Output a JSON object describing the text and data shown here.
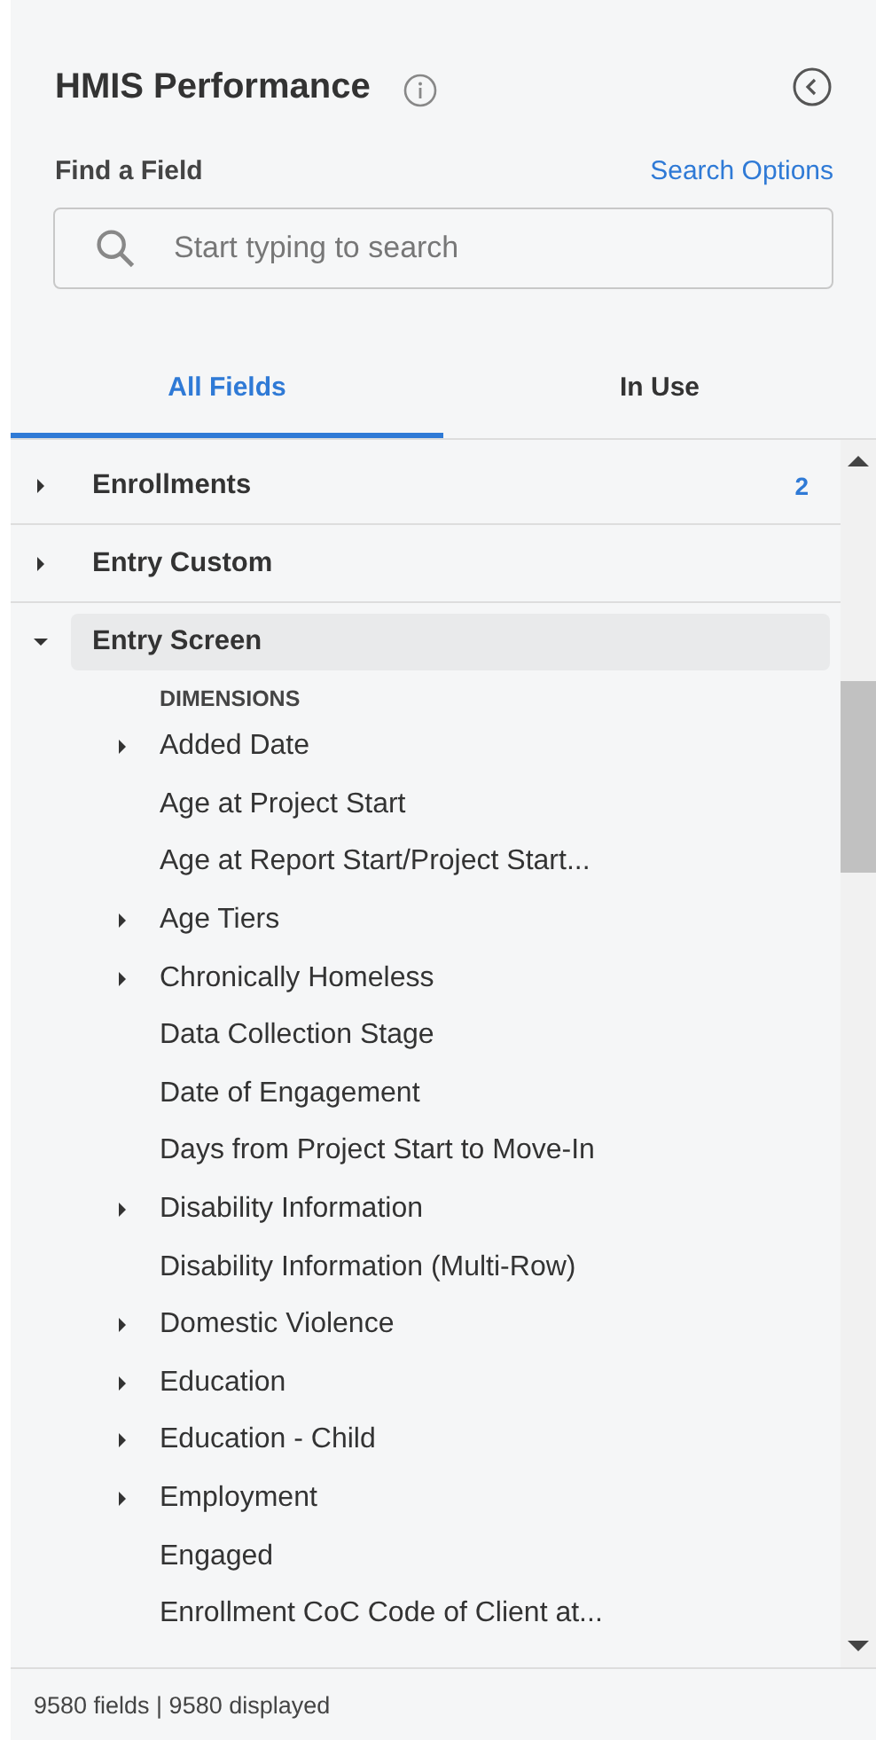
{
  "header": {
    "title": "HMIS Performance"
  },
  "search": {
    "label": "Find a Field",
    "options_link": "Search Options",
    "placeholder": "Start typing to search"
  },
  "tabs": [
    {
      "label": "All Fields",
      "selected": true
    },
    {
      "label": "In Use",
      "selected": false
    }
  ],
  "tree": [
    {
      "label": "Enrollments",
      "expanded": false,
      "count": "2"
    },
    {
      "label": "Entry Custom",
      "expanded": false
    },
    {
      "label": "Entry Screen",
      "expanded": true,
      "highlighted": true,
      "section": "DIMENSIONS",
      "children": [
        {
          "label": "Added Date",
          "kind": "folder",
          "expanded": false
        },
        {
          "label": "Age at Project Start",
          "kind": "field"
        },
        {
          "label": "Age at Report Start/Project Start...",
          "kind": "field"
        },
        {
          "label": "Age Tiers",
          "kind": "folder",
          "expanded": false
        },
        {
          "label": "Chronically Homeless",
          "kind": "folder",
          "expanded": false
        },
        {
          "label": "Data Collection Stage",
          "kind": "field"
        },
        {
          "label": "Date of Engagement",
          "kind": "field"
        },
        {
          "label": "Days from Project Start to Move-In",
          "kind": "field"
        },
        {
          "label": "Disability Information",
          "kind": "folder",
          "expanded": false
        },
        {
          "label": "Disability Information (Multi-Row)",
          "kind": "field"
        },
        {
          "label": "Domestic Violence",
          "kind": "folder",
          "expanded": false
        },
        {
          "label": "Education",
          "kind": "folder",
          "expanded": false
        },
        {
          "label": "Education - Child",
          "kind": "folder",
          "expanded": false
        },
        {
          "label": "Employment",
          "kind": "folder",
          "expanded": false
        },
        {
          "label": "Engaged",
          "kind": "field"
        },
        {
          "label": "Enrollment CoC Code of Client at...",
          "kind": "field"
        }
      ]
    }
  ],
  "status_bar": "9580 fields | 9580 displayed"
}
